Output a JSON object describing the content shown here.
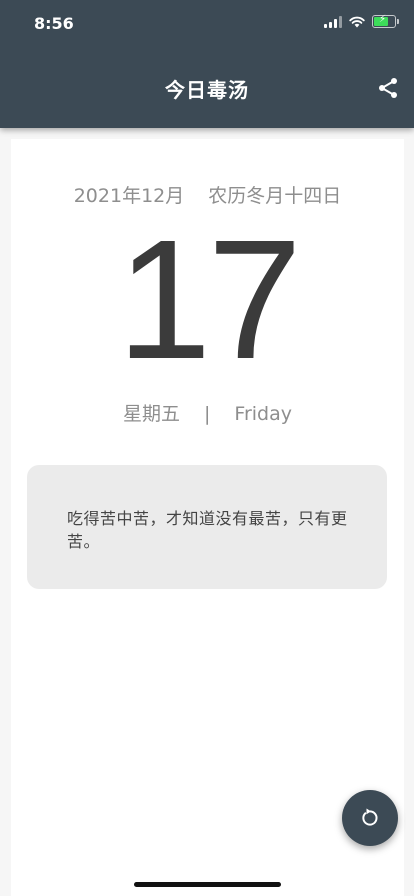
{
  "status_bar": {
    "time": "8:56",
    "icons": [
      "signal-icon",
      "wifi-icon",
      "battery-charging-icon"
    ],
    "battery_color": "#3ddc5a"
  },
  "header": {
    "title": "今日毒汤",
    "background": "#3c4a55",
    "share_icon": "share-icon"
  },
  "date": {
    "gregorian": "2021年12月",
    "lunar": "农历冬月十四日",
    "day": "17",
    "weekday_cn": "星期五",
    "separator": "|",
    "weekday_en": "Friday"
  },
  "quote": {
    "text": "吃得苦中苦，才知道没有最苦，只有更苦。"
  },
  "fab": {
    "icon": "refresh-icon"
  }
}
